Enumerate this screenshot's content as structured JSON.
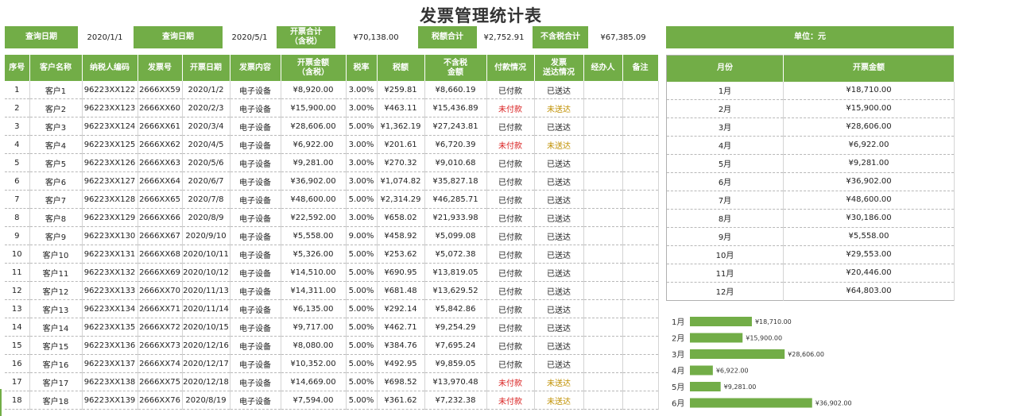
{
  "title": "发票管理统计表",
  "summary": {
    "query_date_label_1": "查询日期",
    "query_date_1": "2020/1/1",
    "query_date_label_2": "查询日期",
    "query_date_2": "2020/5/1",
    "invoice_total_label": "开票合计\n（含税）",
    "invoice_total": "¥70,138.00",
    "tax_total_label": "税额合计",
    "tax_total": "¥2,752.91",
    "net_total_label": "不含税合计",
    "net_total": "¥67,385.09",
    "unit_label": "单位：元"
  },
  "main_table": {
    "columns": [
      "序号",
      "客户名称",
      "纳税人编码",
      "发票号",
      "开票日期",
      "发票内容",
      "开票金额\n（含税）",
      "税率",
      "税额",
      "不含税\n金额",
      "付款情况",
      "发票\n送达情况",
      "经办人",
      "备注"
    ],
    "rows": [
      [
        "1",
        "客户1",
        "96223XX122",
        "2666XX59",
        "2020/1/2",
        "电子设备",
        "¥8,920.00",
        "3.00%",
        "¥259.81",
        "¥8,660.19",
        "已付款",
        "已送达",
        "",
        ""
      ],
      [
        "2",
        "客户2",
        "96223XX123",
        "2666XX60",
        "2020/2/3",
        "电子设备",
        "¥15,900.00",
        "3.00%",
        "¥463.11",
        "¥15,436.89",
        "未付款",
        "未送达",
        "",
        ""
      ],
      [
        "3",
        "客户3",
        "96223XX124",
        "2666XX61",
        "2020/3/4",
        "电子设备",
        "¥28,606.00",
        "5.00%",
        "¥1,362.19",
        "¥27,243.81",
        "已付款",
        "已送达",
        "",
        ""
      ],
      [
        "4",
        "客户4",
        "96223XX125",
        "2666XX62",
        "2020/4/5",
        "电子设备",
        "¥6,922.00",
        "3.00%",
        "¥201.61",
        "¥6,720.39",
        "未付款",
        "未送达",
        "",
        ""
      ],
      [
        "5",
        "客户5",
        "96223XX126",
        "2666XX63",
        "2020/5/6",
        "电子设备",
        "¥9,281.00",
        "3.00%",
        "¥270.32",
        "¥9,010.68",
        "已付款",
        "已送达",
        "",
        ""
      ],
      [
        "6",
        "客户6",
        "96223XX127",
        "2666XX64",
        "2020/6/7",
        "电子设备",
        "¥36,902.00",
        "3.00%",
        "¥1,074.82",
        "¥35,827.18",
        "已付款",
        "已送达",
        "",
        ""
      ],
      [
        "7",
        "客户7",
        "96223XX128",
        "2666XX65",
        "2020/7/8",
        "电子设备",
        "¥48,600.00",
        "5.00%",
        "¥2,314.29",
        "¥46,285.71",
        "已付款",
        "已送达",
        "",
        ""
      ],
      [
        "8",
        "客户8",
        "96223XX129",
        "2666XX66",
        "2020/8/9",
        "电子设备",
        "¥22,592.00",
        "3.00%",
        "¥658.02",
        "¥21,933.98",
        "已付款",
        "已送达",
        "",
        ""
      ],
      [
        "9",
        "客户9",
        "96223XX130",
        "2666XX67",
        "2020/9/10",
        "电子设备",
        "¥5,558.00",
        "9.00%",
        "¥458.92",
        "¥5,099.08",
        "已付款",
        "已送达",
        "",
        ""
      ],
      [
        "10",
        "客户10",
        "96223XX131",
        "2666XX68",
        "2020/10/11",
        "电子设备",
        "¥5,326.00",
        "5.00%",
        "¥253.62",
        "¥5,072.38",
        "已付款",
        "已送达",
        "",
        ""
      ],
      [
        "11",
        "客户11",
        "96223XX132",
        "2666XX69",
        "2020/10/12",
        "电子设备",
        "¥14,510.00",
        "5.00%",
        "¥690.95",
        "¥13,819.05",
        "已付款",
        "已送达",
        "",
        ""
      ],
      [
        "12",
        "客户12",
        "96223XX133",
        "2666XX70",
        "2020/11/13",
        "电子设备",
        "¥14,311.00",
        "5.00%",
        "¥681.48",
        "¥13,629.52",
        "已付款",
        "已送达",
        "",
        ""
      ],
      [
        "13",
        "客户13",
        "96223XX134",
        "2666XX71",
        "2020/11/14",
        "电子设备",
        "¥6,135.00",
        "5.00%",
        "¥292.14",
        "¥5,842.86",
        "已付款",
        "已送达",
        "",
        ""
      ],
      [
        "14",
        "客户14",
        "96223XX135",
        "2666XX72",
        "2020/10/15",
        "电子设备",
        "¥9,717.00",
        "5.00%",
        "¥462.71",
        "¥9,254.29",
        "已付款",
        "已送达",
        "",
        ""
      ],
      [
        "15",
        "客户15",
        "96223XX136",
        "2666XX73",
        "2020/12/16",
        "电子设备",
        "¥8,080.00",
        "5.00%",
        "¥384.76",
        "¥7,695.24",
        "已付款",
        "已送达",
        "",
        ""
      ],
      [
        "16",
        "客户16",
        "96223XX137",
        "2666XX74",
        "2020/12/17",
        "电子设备",
        "¥10,352.00",
        "5.00%",
        "¥492.95",
        "¥9,859.05",
        "已付款",
        "已送达",
        "",
        ""
      ],
      [
        "17",
        "客户17",
        "96223XX138",
        "2666XX75",
        "2020/12/18",
        "电子设备",
        "¥14,669.00",
        "5.00%",
        "¥698.52",
        "¥13,970.48",
        "未付款",
        "未送达",
        "",
        ""
      ],
      [
        "18",
        "客户18",
        "96223XX139",
        "2666XX76",
        "2020/8/19",
        "电子设备",
        "¥7,594.00",
        "5.00%",
        "¥361.62",
        "¥7,232.38",
        "未付款",
        "未送达",
        "",
        ""
      ]
    ]
  },
  "month_table": {
    "columns": [
      "月份",
      "开票金额"
    ],
    "rows": [
      [
        "1月",
        "¥18,710.00"
      ],
      [
        "2月",
        "¥15,900.00"
      ],
      [
        "3月",
        "¥28,606.00"
      ],
      [
        "4月",
        "¥6,922.00"
      ],
      [
        "5月",
        "¥9,281.00"
      ],
      [
        "6月",
        "¥36,902.00"
      ],
      [
        "7月",
        "¥48,600.00"
      ],
      [
        "8月",
        "¥30,186.00"
      ],
      [
        "9月",
        "¥5,558.00"
      ],
      [
        "10月",
        "¥29,553.00"
      ],
      [
        "11月",
        "¥20,446.00"
      ],
      [
        "12月",
        "¥64,803.00"
      ]
    ]
  },
  "chart_data": {
    "type": "bar",
    "orientation": "horizontal",
    "categories": [
      "1月",
      "2月",
      "3月",
      "4月",
      "5月",
      "6月"
    ],
    "values": [
      18710,
      15900,
      28606,
      6922,
      9281,
      36902
    ],
    "value_labels": [
      "¥18,710.00",
      "¥15,900.00",
      "¥28,606.00",
      "¥6,922.00",
      "¥9,281.00",
      "¥36,902.00"
    ],
    "xlim": [
      0,
      64803
    ],
    "color": "#72ad47"
  },
  "colors": {
    "accent": "#72ad47",
    "unpaid": "#d92020",
    "undelivered": "#c09000"
  }
}
